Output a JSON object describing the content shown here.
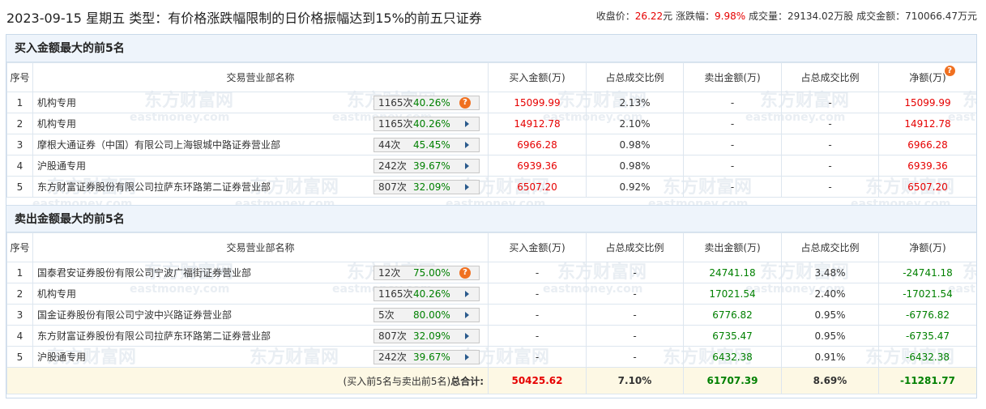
{
  "header": {
    "date": "2023-09-15",
    "weekday": "星期五",
    "type_label": "类型：",
    "type_text": "有价格涨跌幅限制的日价格振幅达到15%的前五只证券",
    "close_label": "收盘价：",
    "close_value": "26.22",
    "close_unit": "元",
    "change_label": "涨跌幅：",
    "change_value": "9.98%",
    "volume_label": "成交量：",
    "volume_value": "29134.02万股",
    "turnover_label": "成交金额：",
    "turnover_value": "710066.47万元"
  },
  "buy_section": {
    "title": "买入金额最大的前5名",
    "columns": [
      "序号",
      "交易营业部名称",
      "买入金额(万)",
      "占总成交比例",
      "卖出金额(万)",
      "占总成交比例",
      "净额(万)"
    ],
    "rows": [
      {
        "idx": "1",
        "name": "机构专用",
        "count": "1165次",
        "pct": "40.26%",
        "action": "question",
        "buy": "15099.99",
        "buy_ratio": "2.13%",
        "sell": "-",
        "sell_ratio": "-",
        "net": "15099.99"
      },
      {
        "idx": "2",
        "name": "机构专用",
        "count": "1165次",
        "pct": "40.26%",
        "action": "expand",
        "buy": "14912.78",
        "buy_ratio": "2.10%",
        "sell": "-",
        "sell_ratio": "-",
        "net": "14912.78"
      },
      {
        "idx": "3",
        "name": "摩根大通证券（中国）有限公司上海银城中路证券营业部",
        "count": "44次",
        "pct": "45.45%",
        "action": "expand",
        "buy": "6966.28",
        "buy_ratio": "0.98%",
        "sell": "-",
        "sell_ratio": "-",
        "net": "6966.28"
      },
      {
        "idx": "4",
        "name": "沪股通专用",
        "count": "242次",
        "pct": "39.67%",
        "action": "expand",
        "buy": "6939.36",
        "buy_ratio": "0.98%",
        "sell": "-",
        "sell_ratio": "-",
        "net": "6939.36"
      },
      {
        "idx": "5",
        "name": "东方财富证券股份有限公司拉萨东环路第二证券营业部",
        "count": "807次",
        "pct": "32.09%",
        "action": "expand",
        "buy": "6507.20",
        "buy_ratio": "0.92%",
        "sell": "-",
        "sell_ratio": "-",
        "net": "6507.20"
      }
    ]
  },
  "sell_section": {
    "title": "卖出金额最大的前5名",
    "columns": [
      "序号",
      "交易营业部名称",
      "买入金额(万)",
      "占总成交比例",
      "卖出金额(万)",
      "占总成交比例",
      "净额(万)"
    ],
    "rows": [
      {
        "idx": "1",
        "name": "国泰君安证券股份有限公司宁波广福街证券营业部",
        "count": "12次",
        "pct": "75.00%",
        "action": "question",
        "buy": "-",
        "buy_ratio": "-",
        "sell": "24741.18",
        "sell_ratio": "3.48%",
        "net": "-24741.18"
      },
      {
        "idx": "2",
        "name": "机构专用",
        "count": "1165次",
        "pct": "40.26%",
        "action": "expand",
        "buy": "-",
        "buy_ratio": "-",
        "sell": "17021.54",
        "sell_ratio": "2.40%",
        "net": "-17021.54"
      },
      {
        "idx": "3",
        "name": "国金证券股份有限公司宁波中兴路证券营业部",
        "count": "5次",
        "pct": "80.00%",
        "action": "expand",
        "buy": "-",
        "buy_ratio": "-",
        "sell": "6776.82",
        "sell_ratio": "0.95%",
        "net": "-6776.82"
      },
      {
        "idx": "4",
        "name": "东方财富证券股份有限公司拉萨东环路第二证券营业部",
        "count": "807次",
        "pct": "32.09%",
        "action": "expand",
        "buy": "-",
        "buy_ratio": "-",
        "sell": "6735.47",
        "sell_ratio": "0.95%",
        "net": "-6735.47"
      },
      {
        "idx": "5",
        "name": "沪股通专用",
        "count": "242次",
        "pct": "39.67%",
        "action": "expand",
        "buy": "-",
        "buy_ratio": "-",
        "sell": "6432.38",
        "sell_ratio": "0.91%",
        "net": "-6432.38"
      }
    ]
  },
  "totals": {
    "label_prefix": "(买入前5名与卖出前5名)",
    "label_bold": "总合计:",
    "buy": "50425.62",
    "buy_ratio": "7.10%",
    "sell": "61707.39",
    "sell_ratio": "8.69%",
    "net": "-11281.77"
  },
  "watermark": {
    "cn": "东方财富网",
    "en": "eastmoney.com"
  },
  "colors": {
    "up": "#e60000",
    "down": "#008000",
    "header_bg": "#eef4fb",
    "total_bg": "#fdf8e4",
    "question_icon": "#f07020"
  }
}
